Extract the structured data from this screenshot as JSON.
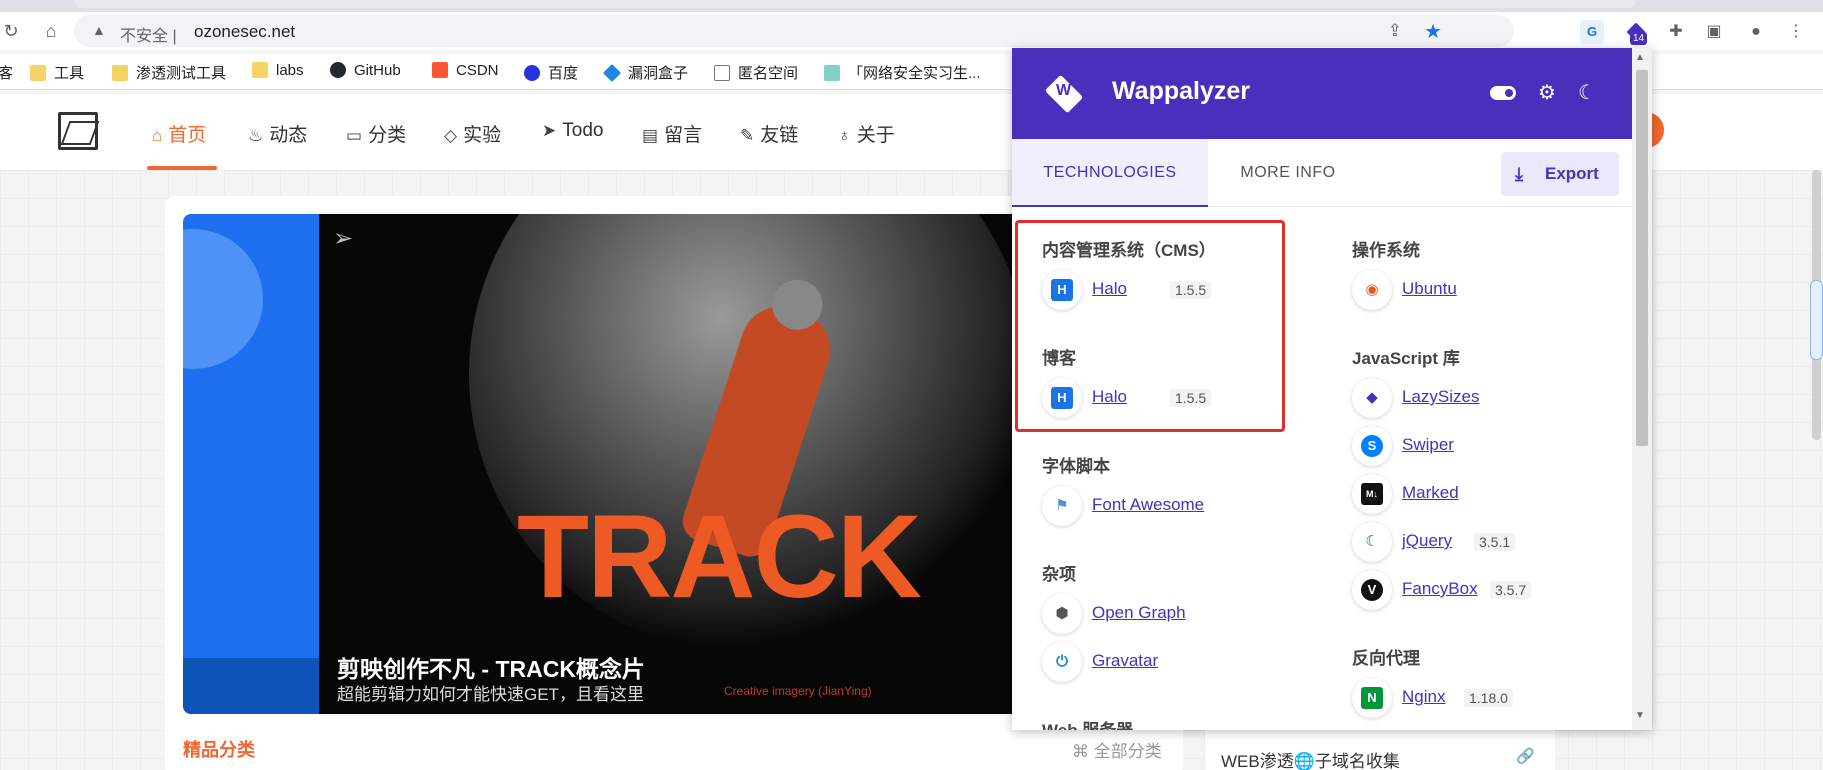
{
  "browser": {
    "warning_icon": "warning-triangle-icon",
    "insecure_label": "不安全",
    "separator": "|",
    "url": "ozonesec.net",
    "extension_badge": "14"
  },
  "bookmarks": [
    {
      "label": "客"
    },
    {
      "label": "工具",
      "icon": "folder-icon"
    },
    {
      "label": "渗透测试工具",
      "icon": "folder-icon"
    },
    {
      "label": "labs",
      "icon": "folder-icon"
    },
    {
      "label": "GitHub",
      "icon": "github-icon"
    },
    {
      "label": "CSDN",
      "icon": "csdn-icon"
    },
    {
      "label": "百度",
      "icon": "baidu-icon"
    },
    {
      "label": "漏洞盒子",
      "icon": "vulbox-icon"
    },
    {
      "label": "匿名空间",
      "icon": "page-icon"
    },
    {
      "label": "「网络安全实习生...",
      "icon": "b-icon"
    }
  ],
  "site": {
    "nav": [
      {
        "label": "首页",
        "icon": "home-icon"
      },
      {
        "label": "动态",
        "icon": "flame-icon"
      },
      {
        "label": "分类",
        "icon": "book-icon"
      },
      {
        "label": "实验",
        "icon": "shield-icon"
      },
      {
        "label": "Todo",
        "icon": "send-icon"
      },
      {
        "label": "留言",
        "icon": "message-icon"
      },
      {
        "label": "友链",
        "icon": "feather-icon"
      },
      {
        "label": "关于",
        "icon": "bulb-icon"
      }
    ],
    "banner": {
      "big_text": "TRACK",
      "title": "剪映创作不凡 - TRACK概念片",
      "subtitle": "超能剪辑力如何才能快速GET，且看这里",
      "credit": "Creative imagery (JianYing)"
    },
    "section_title": "精品分类",
    "all_categories": "全部分类",
    "side_card_title": "WEB渗透🌐子域名收集"
  },
  "wappalyzer": {
    "title": "Wappalyzer",
    "tabs": [
      {
        "label": "TECHNOLOGIES",
        "active": true
      },
      {
        "label": "MORE INFO",
        "active": false
      }
    ],
    "export_label": "Export",
    "left_column": [
      {
        "category": "内容管理系统（CMS）",
        "items": [
          {
            "name": "Halo",
            "version": "1.5.5",
            "icon": "halo-icon"
          }
        ]
      },
      {
        "category": "博客",
        "items": [
          {
            "name": "Halo",
            "version": "1.5.5",
            "icon": "halo-icon"
          }
        ]
      },
      {
        "category": "字体脚本",
        "items": [
          {
            "name": "Font Awesome",
            "version": "",
            "icon": "font-awesome-icon"
          }
        ]
      },
      {
        "category": "杂项",
        "items": [
          {
            "name": "Open Graph",
            "version": "",
            "icon": "open-graph-icon"
          },
          {
            "name": "Gravatar",
            "version": "",
            "icon": "gravatar-icon"
          }
        ]
      },
      {
        "category": "Web 服务器",
        "items": []
      }
    ],
    "right_column": [
      {
        "category": "操作系统",
        "items": [
          {
            "name": "Ubuntu",
            "version": "",
            "icon": "ubuntu-icon"
          }
        ]
      },
      {
        "category": "JavaScript 库",
        "items": [
          {
            "name": "LazySizes",
            "version": "",
            "icon": "lazysizes-icon"
          },
          {
            "name": "Swiper",
            "version": "",
            "icon": "swiper-icon"
          },
          {
            "name": "Marked",
            "version": "",
            "icon": "marked-icon"
          },
          {
            "name": "jQuery",
            "version": "3.5.1",
            "icon": "jquery-icon"
          },
          {
            "name": "FancyBox",
            "version": "3.5.7",
            "icon": "fancybox-icon"
          }
        ]
      },
      {
        "category": "反向代理",
        "items": [
          {
            "name": "Nginx",
            "version": "1.18.0",
            "icon": "nginx-icon"
          }
        ]
      }
    ]
  },
  "colors": {
    "wappalyzer_purple": "#4a2fbd",
    "site_accent": "#f1672f",
    "highlight_box": "#e32e2e"
  }
}
